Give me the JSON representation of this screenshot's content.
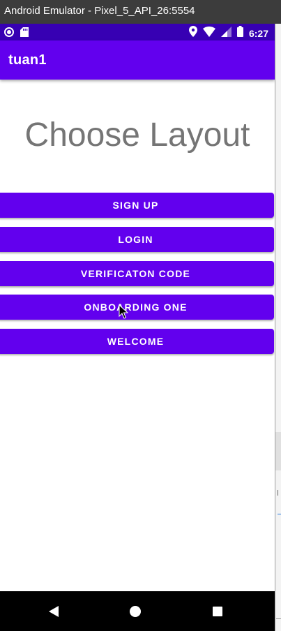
{
  "window": {
    "title": "Android Emulator - Pixel_5_API_26:5554"
  },
  "status_bar": {
    "time": "6:27",
    "left_icons": [
      "record-icon",
      "sd-card-icon"
    ],
    "right_icons": [
      "location-icon",
      "wifi-icon",
      "signal-icon",
      "battery-icon"
    ]
  },
  "app_bar": {
    "title": "tuan1"
  },
  "main": {
    "heading": "Choose Layout",
    "buttons": [
      {
        "label": "SIGN UP"
      },
      {
        "label": "LOGIN"
      },
      {
        "label": "VERIFICATON CODE"
      },
      {
        "label": "ONBOARDING ONE"
      },
      {
        "label": "WELCOME"
      }
    ]
  },
  "nav_bar": {
    "icons": [
      "back-icon",
      "home-icon",
      "recents-icon"
    ]
  },
  "colors": {
    "primary": "#6200ee",
    "primary_dark": "#3700b3",
    "heading_text": "#757575",
    "nav_bar": "#000000"
  }
}
